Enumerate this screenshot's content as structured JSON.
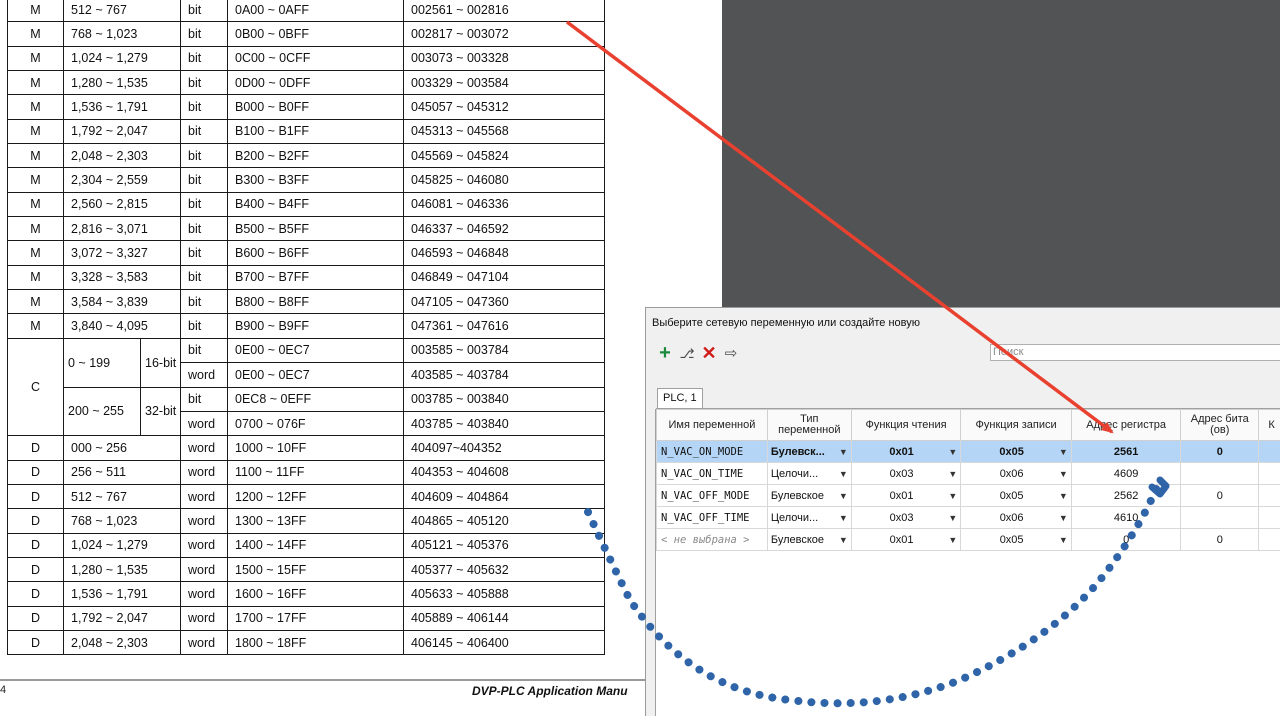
{
  "manual": {
    "rows": [
      {
        "device": "M",
        "range": "512 ~ 767",
        "type": "bit",
        "hex": "0A00 ~ 0AFF",
        "modbus": "002561 ~ 002816"
      },
      {
        "device": "M",
        "range": "768 ~ 1,023",
        "type": "bit",
        "hex": "0B00 ~ 0BFF",
        "modbus": "002817 ~ 003072"
      },
      {
        "device": "M",
        "range": "1,024 ~ 1,279",
        "type": "bit",
        "hex": "0C00 ~ 0CFF",
        "modbus": "003073 ~ 003328"
      },
      {
        "device": "M",
        "range": "1,280 ~ 1,535",
        "type": "bit",
        "hex": "0D00 ~ 0DFF",
        "modbus": "003329 ~ 003584"
      },
      {
        "device": "M",
        "range": "1,536 ~ 1,791",
        "type": "bit",
        "hex": "B000 ~ B0FF",
        "modbus": "045057 ~ 045312"
      },
      {
        "device": "M",
        "range": "1,792 ~ 2,047",
        "type": "bit",
        "hex": "B100 ~ B1FF",
        "modbus": "045313 ~ 045568"
      },
      {
        "device": "M",
        "range": "2,048 ~ 2,303",
        "type": "bit",
        "hex": "B200 ~ B2FF",
        "modbus": "045569 ~ 045824"
      },
      {
        "device": "M",
        "range": "2,304 ~ 2,559",
        "type": "bit",
        "hex": "B300 ~ B3FF",
        "modbus": "045825 ~ 046080"
      },
      {
        "device": "M",
        "range": "2,560 ~ 2,815",
        "type": "bit",
        "hex": "B400 ~ B4FF",
        "modbus": "046081 ~ 046336"
      },
      {
        "device": "M",
        "range": "2,816 ~ 3,071",
        "type": "bit",
        "hex": "B500 ~ B5FF",
        "modbus": "046337 ~ 046592"
      },
      {
        "device": "M",
        "range": "3,072 ~ 3,327",
        "type": "bit",
        "hex": "B600 ~ B6FF",
        "modbus": "046593 ~ 046848"
      },
      {
        "device": "M",
        "range": "3,328 ~ 3,583",
        "type": "bit",
        "hex": "B700 ~ B7FF",
        "modbus": "046849 ~ 047104"
      },
      {
        "device": "M",
        "range": "3,584 ~ 3,839",
        "type": "bit",
        "hex": "B800 ~ B8FF",
        "modbus": "047105 ~ 047360"
      },
      {
        "device": "M",
        "range": "3,840 ~ 4,095",
        "type": "bit",
        "hex": "B900 ~ B9FF",
        "modbus": "047361 ~ 047616"
      }
    ],
    "c_block": {
      "device": "C",
      "group1": {
        "range": "0 ~ 199",
        "width": "16-bit",
        "rows": [
          {
            "type": "bit",
            "hex": "0E00 ~ 0EC7",
            "modbus": "003585 ~ 003784"
          },
          {
            "type": "word",
            "hex": "0E00 ~ 0EC7",
            "modbus": "403585 ~ 403784"
          }
        ]
      },
      "group2": {
        "range": "200 ~ 255",
        "width": "32-bit",
        "rows": [
          {
            "type": "bit",
            "hex": "0EC8 ~ 0EFF",
            "modbus": "003785 ~ 003840"
          },
          {
            "type": "word",
            "hex": "0700 ~ 076F",
            "modbus": "403785 ~ 403840"
          }
        ]
      }
    },
    "d_rows": [
      {
        "device": "D",
        "range": "000 ~ 256",
        "type": "word",
        "hex": "1000 ~ 10FF",
        "modbus": "404097~404352"
      },
      {
        "device": "D",
        "range": "256 ~ 511",
        "type": "word",
        "hex": "1100 ~ 11FF",
        "modbus": "404353 ~ 404608"
      },
      {
        "device": "D",
        "range": "512 ~ 767",
        "type": "word",
        "hex": "1200 ~ 12FF",
        "modbus": "404609 ~ 404864"
      },
      {
        "device": "D",
        "range": "768 ~ 1,023",
        "type": "word",
        "hex": "1300 ~ 13FF",
        "modbus": "404865 ~ 405120"
      },
      {
        "device": "D",
        "range": "1,024 ~ 1,279",
        "type": "word",
        "hex": "1400 ~ 14FF",
        "modbus": "405121 ~ 405376"
      },
      {
        "device": "D",
        "range": "1,280 ~ 1,535",
        "type": "word",
        "hex": "1500 ~ 15FF",
        "modbus": "405377 ~ 405632"
      },
      {
        "device": "D",
        "range": "1,536 ~ 1,791",
        "type": "word",
        "hex": "1600 ~ 16FF",
        "modbus": "405633 ~ 405888"
      },
      {
        "device": "D",
        "range": "1,792 ~ 2,047",
        "type": "word",
        "hex": "1700 ~ 17FF",
        "modbus": "405889 ~ 406144"
      },
      {
        "device": "D",
        "range": "2,048 ~ 2,303",
        "type": "word",
        "hex": "1800 ~ 18FF",
        "modbus": "406145 ~ 406400"
      }
    ],
    "footer": {
      "page": "4",
      "title": "DVP-PLC Application Manu"
    }
  },
  "dialog": {
    "title": "Выберите сетевую переменную или создайте новую",
    "search_placeholder": "Поиск",
    "tab": "PLC, 1",
    "columns": [
      "Имя переменной",
      "Тип переменной",
      "Функция чтения",
      "Функция записи",
      "Адрес регистра",
      "Адрес бита (ов)",
      "К"
    ],
    "rows": [
      {
        "name": "N_VAC_ON_MODE",
        "type": "Булевск...",
        "read": "0x01",
        "write": "0x05",
        "reg": "2561",
        "bit": "0",
        "selected": true
      },
      {
        "name": "N_VAC_ON_TIME",
        "type": "Целочи...",
        "read": "0x03",
        "write": "0x06",
        "reg": "4609",
        "bit": "",
        "selected": false
      },
      {
        "name": "N_VAC_OFF_MODE",
        "type": "Булевское",
        "read": "0x01",
        "write": "0x05",
        "reg": "2562",
        "bit": "0",
        "selected": false
      },
      {
        "name": "N_VAC_OFF_TIME",
        "type": "Целочи...",
        "read": "0x03",
        "write": "0x06",
        "reg": "4610",
        "bit": "",
        "selected": false
      },
      {
        "name": "< не выбрана >",
        "type": "Булевское",
        "read": "0x01",
        "write": "0x05",
        "reg": "0",
        "bit": "0",
        "selected": false,
        "placeholder": true
      }
    ],
    "colors": {
      "selection": "#b4d5f5",
      "add_icon": "#1a8a3c",
      "delete_icon": "#d11a1a"
    }
  },
  "annotations": {
    "arrow_color": "#e8412f",
    "dotted_arc_color": "#2f65a8"
  }
}
